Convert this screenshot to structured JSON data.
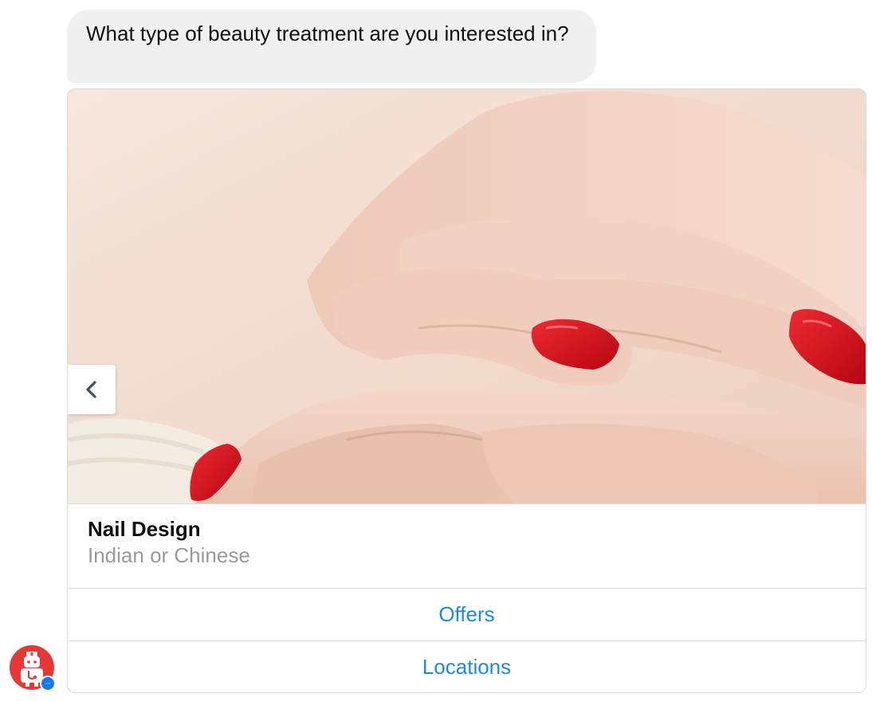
{
  "message": {
    "text": "What type of beauty treatment are you interested in?"
  },
  "card": {
    "image": "manicured-hands-red-nails-photo",
    "title": "Nail Design",
    "subtitle": "Indian or Chinese",
    "buttons": [
      {
        "label": "Offers"
      },
      {
        "label": "Locations"
      }
    ],
    "nav_icon": "chevron-left-icon"
  },
  "avatar": {
    "icon": "doctor-bot-icon",
    "badge_icon": "messenger-icon"
  },
  "colors": {
    "bubble_bg": "#f0f0f0",
    "button_text": "#1e88e5",
    "subtitle_text": "#9a9a9a",
    "avatar_bg": "#e53935",
    "nail_red": "#d0101c"
  }
}
